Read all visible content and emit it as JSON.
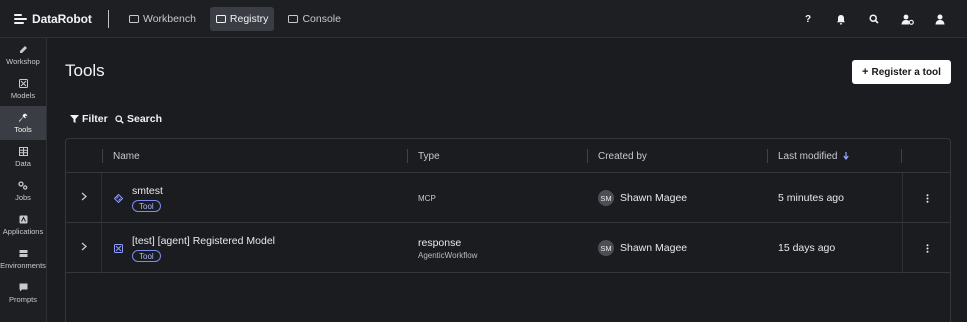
{
  "app": {
    "brand": "DataRobot",
    "nav": [
      {
        "label": "Workbench",
        "active": false
      },
      {
        "label": "Registry",
        "active": true
      },
      {
        "label": "Console",
        "active": false
      }
    ],
    "help_glyph": "?"
  },
  "sidebar": {
    "items": [
      {
        "label": "Workshop",
        "icon": "workshop-icon",
        "active": false
      },
      {
        "label": "Models",
        "icon": "models-icon",
        "active": false
      },
      {
        "label": "Tools",
        "icon": "wrench-icon",
        "active": true
      },
      {
        "label": "Data",
        "icon": "data-icon",
        "active": false
      },
      {
        "label": "Jobs",
        "icon": "jobs-icon",
        "active": false
      },
      {
        "label": "Applications",
        "icon": "applications-icon",
        "active": false
      },
      {
        "label": "Environments",
        "icon": "environments-icon",
        "active": false
      },
      {
        "label": "Prompts",
        "icon": "prompts-icon",
        "active": false
      }
    ]
  },
  "page": {
    "title": "Tools",
    "register_button": "Register a tool",
    "filter_label": "Filter",
    "search_label": "Search"
  },
  "table": {
    "columns": {
      "name": "Name",
      "type": "Type",
      "created_by": "Created by",
      "last_modified": "Last modified"
    },
    "sort": {
      "column": "last_modified",
      "direction": "descending"
    },
    "rows": [
      {
        "name": "smtest",
        "badge": "Tool",
        "type": "MCP",
        "type_sub": "",
        "creator_initials": "SM",
        "creator": "Shawn Magee",
        "modified": "5 minutes ago"
      },
      {
        "name": "[test] [agent] Registered Model",
        "badge": "Tool",
        "type": "response",
        "type_sub": "AgenticWorkflow",
        "creator_initials": "SM",
        "creator": "Shawn Magee",
        "modified": "15 days ago"
      }
    ]
  },
  "colors": {
    "background": "#1a1c1f",
    "active_nav": "#3a3d43",
    "badge_border": "#7d8cf0",
    "primary_button": "#ffffff"
  }
}
